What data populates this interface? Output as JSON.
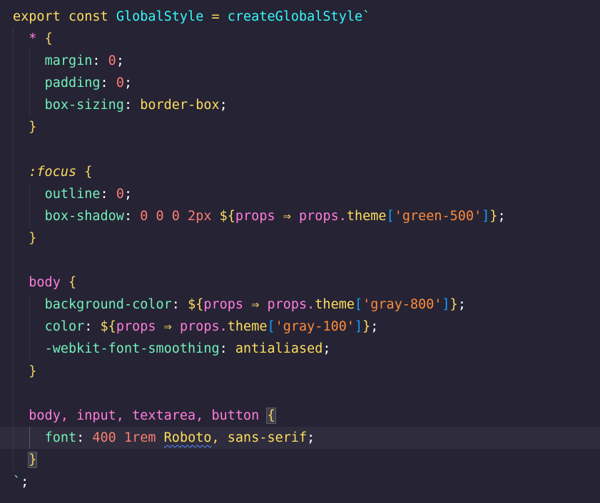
{
  "code": {
    "l1": {
      "export": "export",
      "const": "const",
      "name": "GlobalStyle",
      "eq": "=",
      "fn": "createGlobalStyle",
      "tick": "`"
    },
    "l2": {
      "sel": "*",
      "brace": "{"
    },
    "l3": {
      "prop": "margin",
      "colon": ":",
      "val": "0",
      "semi": ";"
    },
    "l4": {
      "prop": "padding",
      "colon": ":",
      "val": "0",
      "semi": ";"
    },
    "l5": {
      "prop": "box-sizing",
      "colon": ":",
      "val": "border-box",
      "semi": ";"
    },
    "l6": {
      "brace": "}"
    },
    "l8": {
      "sel": ":focus",
      "brace": "{"
    },
    "l9": {
      "prop": "outline",
      "colon": ":",
      "val": "0",
      "semi": ";"
    },
    "l10": {
      "prop": "box-shadow",
      "colon": ":",
      "vals": "0 0 0 2px",
      "open": "${",
      "param": "props",
      "arrow": "⇒",
      "obj": "props.",
      "theme": "theme",
      "lb": "[",
      "str": "'green-500'",
      "rb": "]",
      "close": "}",
      "semi": ";"
    },
    "l11": {
      "brace": "}"
    },
    "l13": {
      "sel": "body",
      "brace": "{"
    },
    "l14": {
      "prop": "background-color",
      "colon": ":",
      "open": "${",
      "param": "props",
      "arrow": "⇒",
      "obj": "props.",
      "theme": "theme",
      "lb": "[",
      "str": "'gray-800'",
      "rb": "]",
      "close": "}",
      "semi": ";"
    },
    "l15": {
      "prop": "color",
      "colon": ":",
      "open": "${",
      "param": "props",
      "arrow": "⇒",
      "obj": "props.",
      "theme": "theme",
      "lb": "[",
      "str": "'gray-100'",
      "rb": "]",
      "close": "}",
      "semi": ";"
    },
    "l16": {
      "prop": "-webkit-font-smoothing",
      "colon": ":",
      "val": "antialiased",
      "semi": ";"
    },
    "l17": {
      "brace": "}"
    },
    "l19": {
      "sel": "body, input, textarea, button",
      "brace": "{"
    },
    "l20": {
      "prop": "font",
      "colon": ":",
      "weight": "400",
      "size": "1rem",
      "family": "Roboto",
      "rest": ", sans-serif",
      "semi": ";"
    },
    "l21": {
      "brace": "}"
    },
    "l22": {
      "tick": "`",
      "semi": ";"
    }
  },
  "colors": {
    "background": "#262335",
    "keyword": "#fede5d",
    "function": "#36f9f6",
    "property": "#72f1b8",
    "number": "#f97e72",
    "string": "#ff8b39",
    "param": "#ff7edb"
  }
}
